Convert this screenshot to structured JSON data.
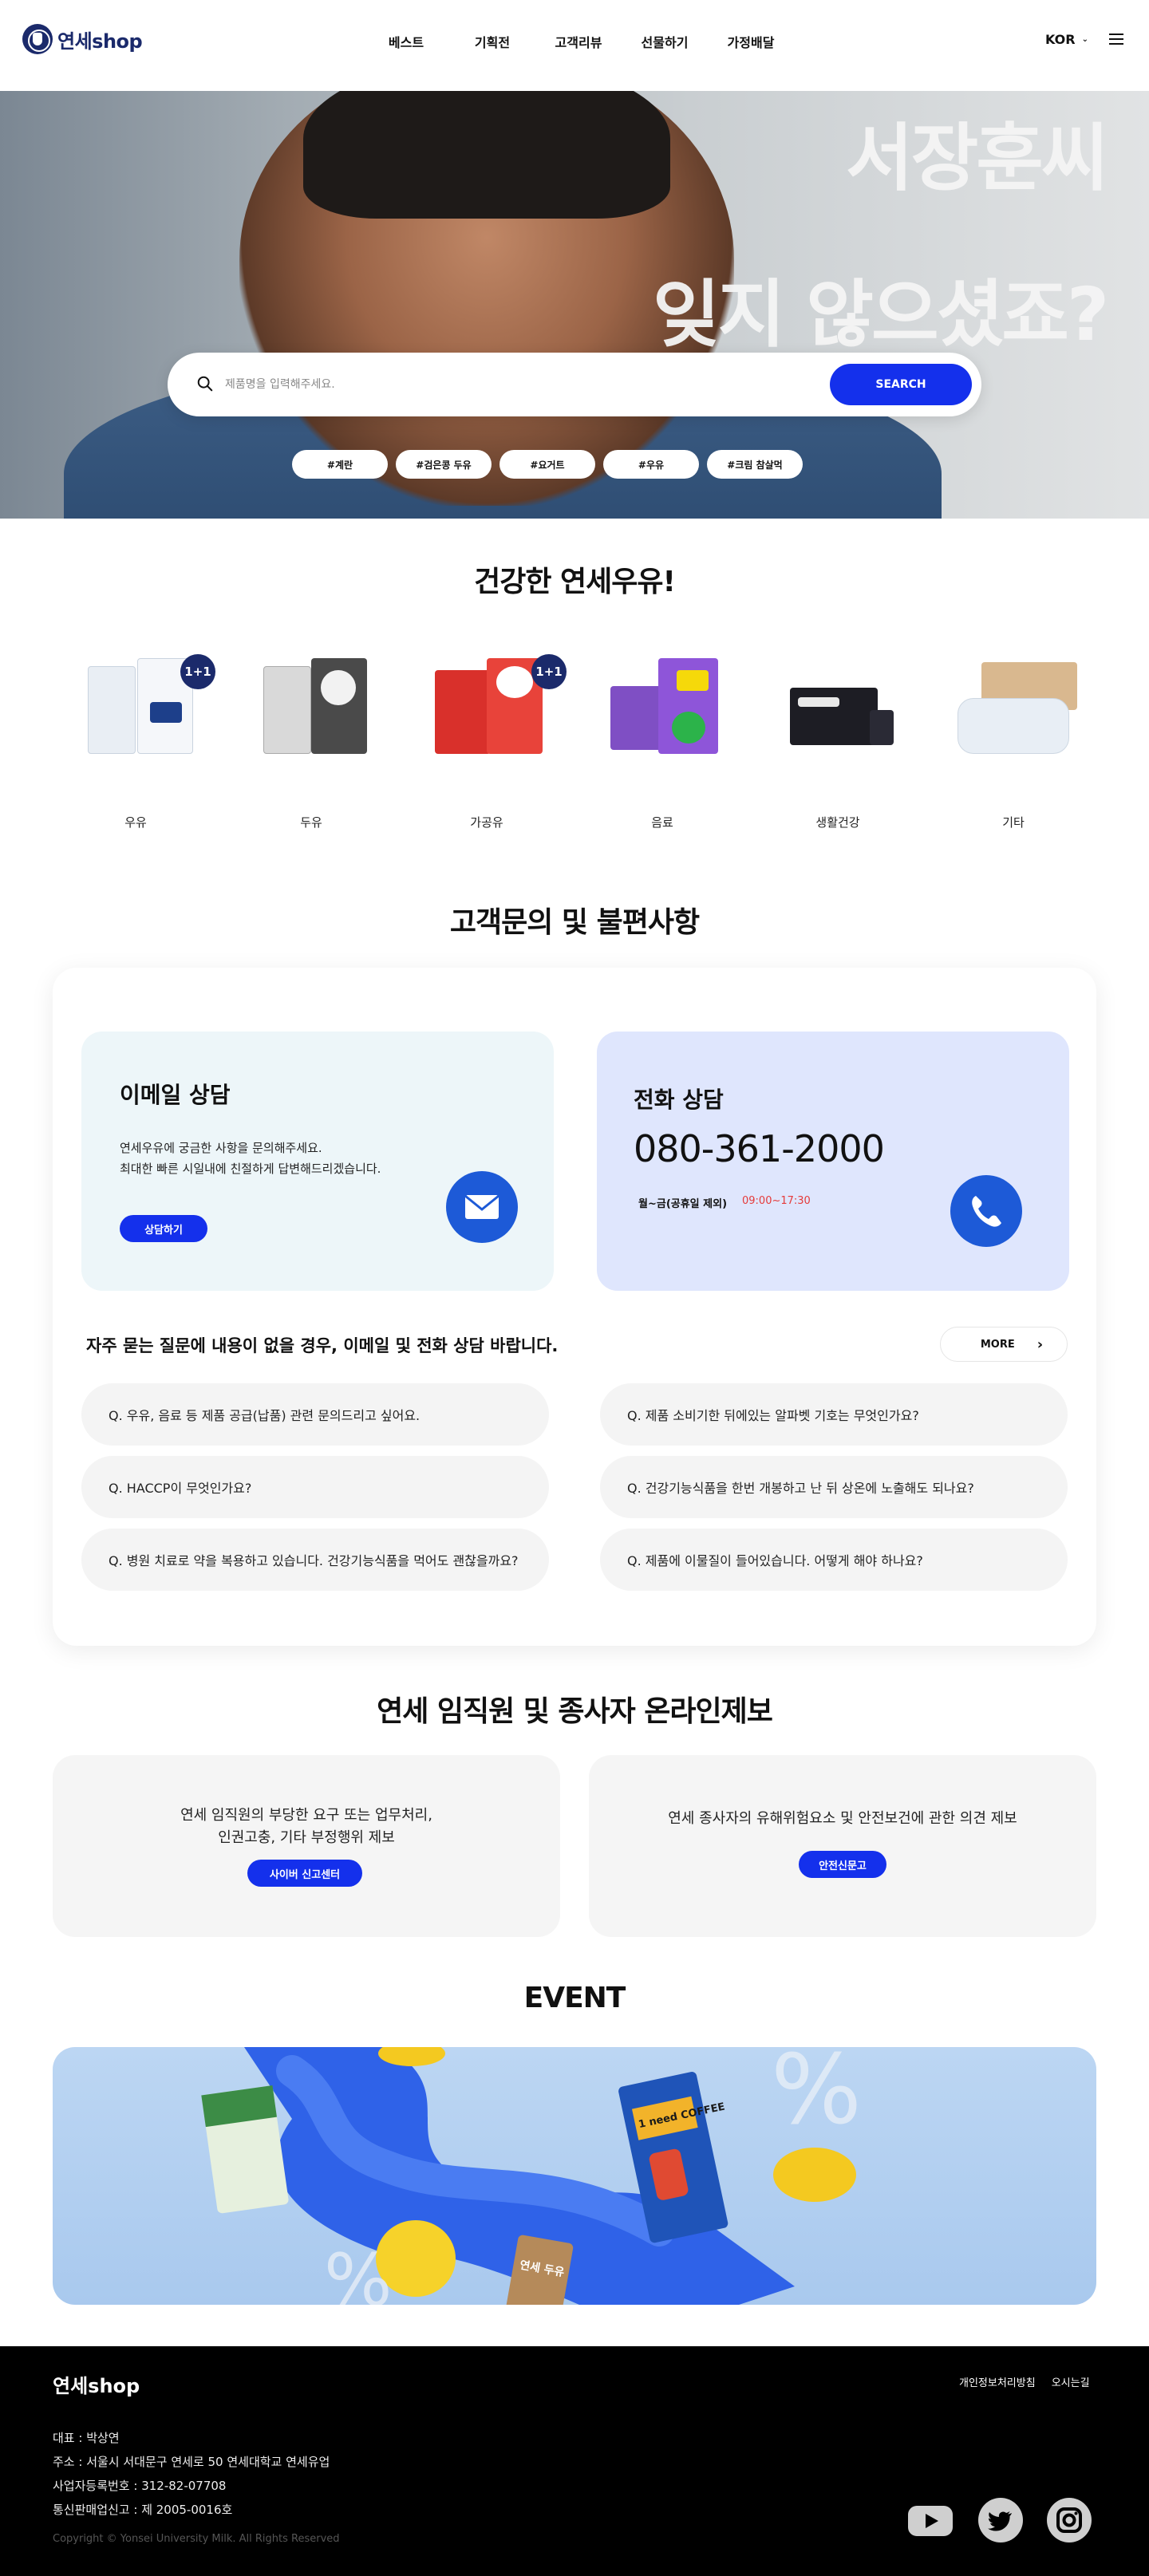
{
  "header": {
    "logo": "연세shop",
    "nav": [
      "베스트",
      "기획전",
      "고객리뷰",
      "선물하기",
      "가정배달"
    ],
    "lang": "KOR"
  },
  "hero": {
    "headline_1": "서장훈씨",
    "headline_2": "잊지 않으셨죠?",
    "search_placeholder": "제품명을 입력해주세요.",
    "search_button": "SEARCH",
    "tags": [
      "#계란",
      "#검은콩 두유",
      "#요거트",
      "#우유",
      "#크림 참살먹"
    ]
  },
  "products": {
    "title": "건강한 연세우유!",
    "categories": [
      {
        "label": "우유",
        "badge": "1+1"
      },
      {
        "label": "두유",
        "badge": ""
      },
      {
        "label": "가공유",
        "badge": "1+1"
      },
      {
        "label": "음료",
        "badge": ""
      },
      {
        "label": "생활건강",
        "badge": ""
      },
      {
        "label": "기타",
        "badge": ""
      }
    ]
  },
  "inquiry": {
    "title": "고객문의 및 불편사항",
    "email": {
      "title": "이메일 상담",
      "desc_1": "연세우유에 궁금한 사항을 문의해주세요.",
      "desc_2": "최대한 빠른 시일내에 친절하게 답변해드리겠습니다.",
      "button": "상담하기"
    },
    "phone": {
      "title": "전화 상담",
      "number": "080-361-2000",
      "days": "월~금(공휴일 제외)",
      "hours": "09:00~17:30"
    },
    "faq_heading": "자주 묻는 질문에 내용이 없을 경우, 이메일 및 전화 상담 바랍니다.",
    "more": "MORE",
    "faqs": [
      "Q. 우유, 음료 등 제품 공급(납품) 관련 문의드리고 싶어요.",
      "Q. 제품 소비기한 뒤에있는 알파벳 기호는 무엇인가요?",
      "Q. HACCP이 무엇인가요?",
      "Q. 건강기능식품을 한번 개봉하고 난 뒤 상온에 노출해도 되나요?",
      "Q. 병원 치료로 약을 복용하고 있습니다. 건강기능식품을 먹어도 괜찮을까요?",
      "Q. 제품에 이물질이 들어있습니다. 어떻게 해야 하나요?"
    ]
  },
  "report": {
    "title": "연세 임직원 및 종사자 온라인제보",
    "left_line1": "연세 임직원의 부당한 요구 또는 업무처리,",
    "left_line2": "인권고충, 기타 부정행위 제보",
    "left_button": "사이버 신고센터",
    "right_line1": "연세 종사자의 유해위험요소 및 안전보건에 관한 의견 제보",
    "right_button": "안전신문고"
  },
  "event": {
    "title": "EVENT",
    "pack_1": "1 need COFFEE",
    "pack_2": "연세 두유"
  },
  "footer": {
    "logo": "연세shop",
    "links": [
      "개인정보처리방침",
      "오시는길"
    ],
    "ceo": "대표 : 박상연",
    "address": "주소 : 서울시 서대문구 연세로 50 연세대학교 연세유업",
    "biz_no": "사업자등록번호 : 312-82-07708",
    "mail_order": "통신판매업신고 : 제 2005-0016호",
    "copyright": "Copyright © Yonsei University Milk. All Rights Reserved"
  },
  "colors": {
    "accent": "#1430ec",
    "brand_navy": "#1b2a6b",
    "email_card": "#edf6f9",
    "phone_card": "#dfe6fd",
    "time_red": "#e53a3a"
  }
}
